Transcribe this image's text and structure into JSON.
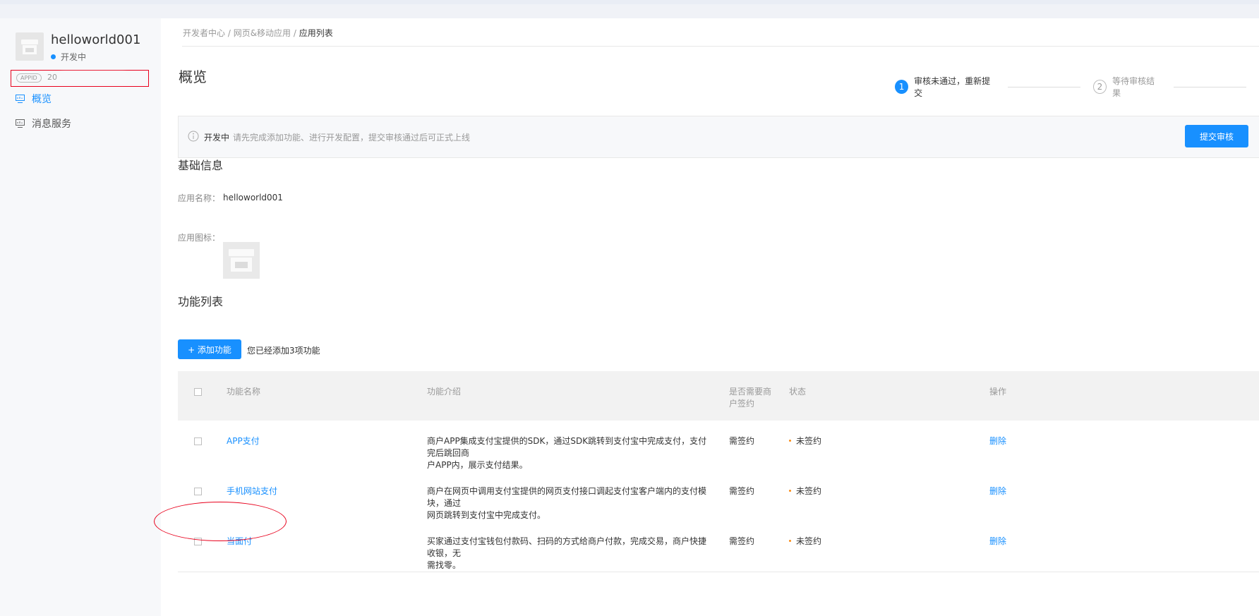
{
  "sidebar": {
    "app_name": "helloworld001",
    "app_status": "开发中",
    "appid_tag": "APPID",
    "appid_value": "20",
    "nav": [
      {
        "label": "概览",
        "icon": "monitor-icon",
        "active": true
      },
      {
        "label": "消息服务",
        "icon": "chart-monitor-icon",
        "active": false
      }
    ]
  },
  "breadcrumb": {
    "root": "开发者中心",
    "sep": " / ",
    "mid": "网页&移动应用",
    "current": "应用列表"
  },
  "overview": {
    "title": "概览",
    "steps": [
      {
        "num": "1",
        "label": "审核未通过，重新提交",
        "state": "current"
      },
      {
        "num": "2",
        "label": "等待审核结果",
        "state": "pending"
      }
    ]
  },
  "notice": {
    "status": "开发中",
    "text": "请先完成添加功能、进行开发配置，提交审核通过后可正式上线",
    "submit_label": "提交审核"
  },
  "basic_info": {
    "title": "基础信息",
    "name_label": "应用名称：",
    "name_value": "helloworld001",
    "icon_label": "应用图标："
  },
  "features": {
    "title": "功能列表",
    "add_label": "+ 添加功能",
    "count_text": "您已经添加3项功能",
    "headers": {
      "name": "功能名称",
      "intro": "功能介绍",
      "sign_line1": "是否需要商",
      "sign_line2": "户签约",
      "status": "状态",
      "action": "操作"
    },
    "rows": [
      {
        "name": "APP支付",
        "desc1": "商户APP集成支付宝提供的SDK，通过SDK跳转到支付宝中完成支付，支付完后跳回商",
        "desc2": "户APP内，展示支付结果。",
        "sign": "需签约",
        "status": "未签约",
        "action": "删除"
      },
      {
        "name": "手机网站支付",
        "desc1": "商户在网页中调用支付宝提供的网页支付接口调起支付宝客户端内的支付模块，通过",
        "desc2": "网页跳转到支付宝中完成支付。",
        "sign": "需签约",
        "status": "未签约",
        "action": "删除"
      },
      {
        "name": "当面付",
        "desc1": "买家通过支付宝钱包付款码、扫码的方式给商户付款，完成交易，商户快捷收银，无",
        "desc2": "需找零。",
        "sign": "需签约",
        "status": "未签约",
        "action": "删除"
      }
    ]
  },
  "colors": {
    "accent": "#1890ff",
    "annotation": "#e8001c",
    "status_dot": "#fa8c16"
  }
}
